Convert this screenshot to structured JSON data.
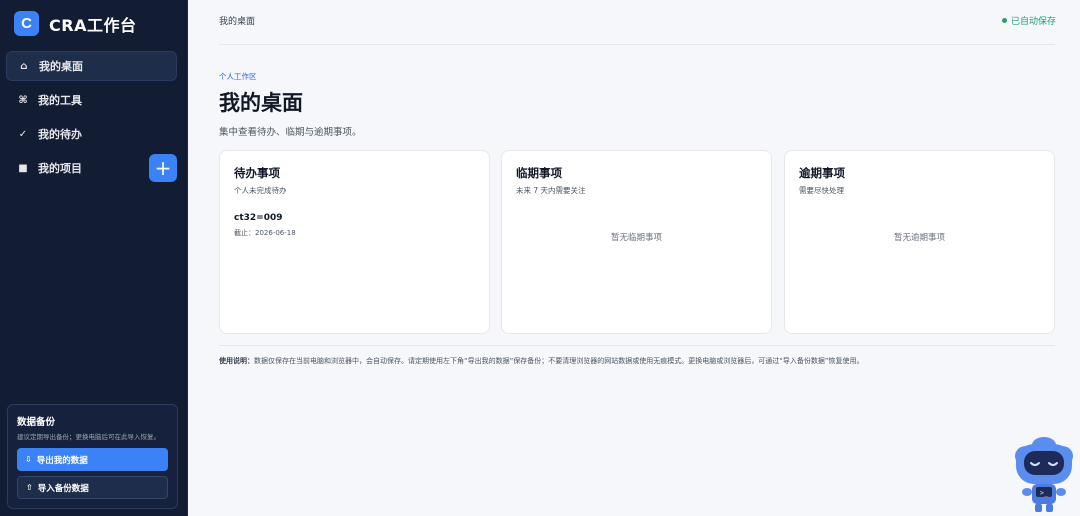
{
  "sidebar": {
    "brand": {
      "logo_letter": "C",
      "name": "CRA工作台"
    },
    "items": [
      {
        "icon": "⌂",
        "icon_name": "home-icon",
        "label": "我的桌面",
        "active": true
      },
      {
        "icon": "⌘",
        "icon_name": "command-icon",
        "label": "我的工具",
        "active": false
      },
      {
        "icon": "✓",
        "icon_name": "check-icon",
        "label": "我的待办",
        "active": false
      },
      {
        "icon": "■",
        "icon_name": "square-icon",
        "label": "我的项目",
        "active": false
      }
    ],
    "add_button": "+",
    "backup": {
      "title": "数据备份",
      "description": "建议定期导出备份；更换电脑后可在此导入恢复。",
      "export_icon": "⇩",
      "export_label": "导出我的数据",
      "import_icon": "⇧",
      "import_label": "导入备份数据"
    }
  },
  "topbar": {
    "breadcrumb": "我的桌面",
    "autosave": "已自动保存"
  },
  "main": {
    "eyebrow": "个人工作区",
    "title": "我的桌面",
    "subtitle": "集中查看待办、临期与逾期事项。",
    "cards": [
      {
        "title": "待办事项",
        "description": "个人未完成待办",
        "items": [
          {
            "name": "ct32=009",
            "due": "截止：2026-06-18"
          }
        ]
      },
      {
        "title": "临期事项",
        "description": "未来 7 天内需要关注",
        "empty": "暂无临期事项"
      },
      {
        "title": "逾期事项",
        "description": "需要尽快处理",
        "empty": "暂无逾期事项"
      }
    ],
    "usage": {
      "label": "使用说明：",
      "text": "数据仅保存在当前电脑和浏览器中，会自动保存。请定期使用左下角“导出我的数据”保存备份；不要清理浏览器的网站数据或使用无痕模式。更换电脑或浏览器后，可通过“导入备份数据”恢复使用。"
    }
  },
  "mascot": {
    "screen_text": ">_"
  },
  "colors": {
    "accent": "#3b82f6",
    "sidebar_bg": "#121c33",
    "success": "#22a06b"
  }
}
